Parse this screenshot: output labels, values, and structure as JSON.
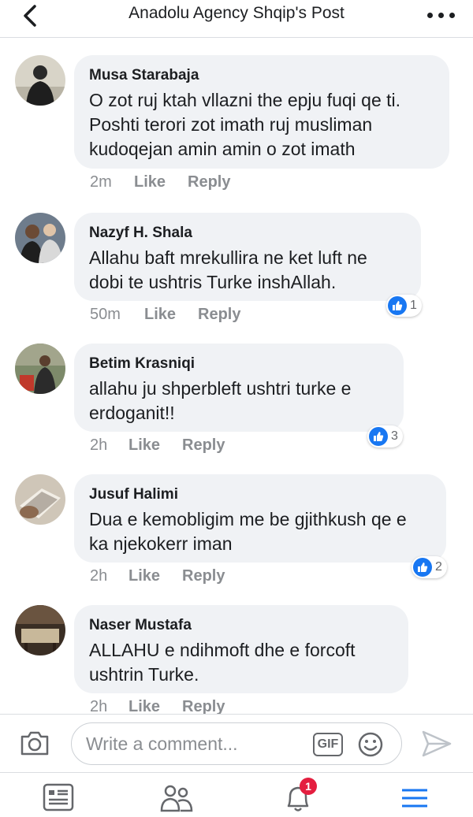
{
  "header": {
    "title": "Anadolu Agency Shqip's Post"
  },
  "comments": [
    {
      "author": "Musa Starabaja",
      "text": "O zot ruj ktah vllazni the epju fuqi qe ti. Poshti terori zot imath ruj musliman kudoqejan amin amin o zot imath",
      "time": "2m",
      "like": "Like",
      "reply": "Reply",
      "reactions": ""
    },
    {
      "author": "Nazyf H. Shala",
      "text": "Allahu baft mrekullira ne ket luft ne dobi te ushtris Turke inshAllah.",
      "time": "50m",
      "like": "Like",
      "reply": "Reply",
      "reactions": "1"
    },
    {
      "author": "Betim Krasniqi",
      "text": "allahu ju shperbleft ushtri turke e erdoganit!!",
      "time": "2h",
      "like": "Like",
      "reply": "Reply",
      "reactions": "3"
    },
    {
      "author": "Jusuf Halimi",
      "text": "Dua e kemobligim me be gjithkush qe e ka njekokerr iman",
      "time": "2h",
      "like": "Like",
      "reply": "Reply",
      "reactions": "2"
    },
    {
      "author": "Naser Mustafa",
      "text": "ALLAHU e ndihmoft dhe e forcoft ushtrin Turke.",
      "time": "2h",
      "like": "Like",
      "reply": "Reply",
      "reactions": ""
    }
  ],
  "composer": {
    "placeholder": "Write a comment...",
    "gif_label": "GIF"
  },
  "tabbar": {
    "notifications_badge": "1"
  },
  "colors": {
    "accent": "#1877f2",
    "badge": "#e41e3f",
    "bubble": "#f0f2f5",
    "meta": "#8a8d91"
  },
  "icons": [
    "back-arrow-icon",
    "more-dots-icon",
    "like-thumb-icon",
    "camera-icon",
    "gif-icon",
    "emoji-icon",
    "send-icon",
    "news-feed-icon",
    "friends-icon",
    "bell-icon",
    "menu-icon"
  ]
}
